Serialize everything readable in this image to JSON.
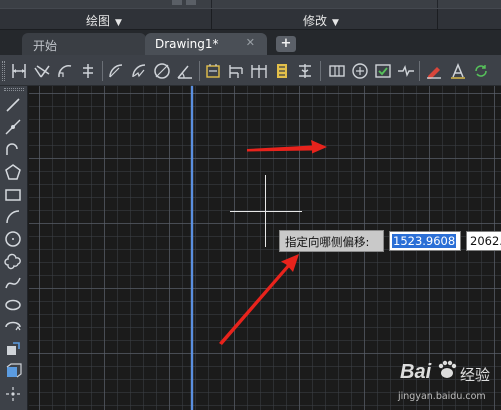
{
  "ribbon": {
    "panels": [
      {
        "label": "绘图",
        "dropdown": "▼"
      },
      {
        "label": "修改",
        "dropdown": "▼"
      }
    ]
  },
  "tabs": [
    {
      "label": "开始",
      "active": false
    },
    {
      "label": "Drawing1*",
      "active": true,
      "close": "✕"
    }
  ],
  "new_tab_label": "+",
  "toolbar_icons": [
    "dim-linear-icon",
    "dim-aligned-icon",
    "dim-arc-icon",
    "dim-ordinate-icon",
    "dim-radius-icon",
    "dim-jogged-icon",
    "dim-diameter-icon",
    "dim-angular-icon",
    "quick-dim-icon",
    "baseline-dim-icon",
    "continue-dim-icon",
    "dim-space-icon",
    "dim-break-icon",
    "tolerance-icon",
    "center-mark-icon",
    "inspect-icon",
    "jogged-linear-icon",
    "dim-edit-icon",
    "text-edit-icon",
    "dim-update-icon"
  ],
  "left_tools": [
    "line-icon",
    "construction-line-icon",
    "polyline-icon",
    "polygon-icon",
    "rectangle-icon",
    "arc-icon",
    "circle-icon",
    "revcloud-icon",
    "spline-icon",
    "ellipse-icon",
    "ellipse-arc-icon",
    "insert-block-icon",
    "make-block-icon",
    "point-icon"
  ],
  "command": {
    "prompt": "指定向哪侧偏移:",
    "value1": "1523.9608",
    "value2": "2062."
  },
  "watermark": {
    "brand": "Bai",
    "brand_suffix": "经验",
    "url": "jingyan.baidu.com"
  },
  "colors": {
    "canvas_bg": "#1b1b1b",
    "axis_line": "#5a8fe0",
    "arrow": "#e8231c",
    "selection": "#2b6fd6"
  }
}
